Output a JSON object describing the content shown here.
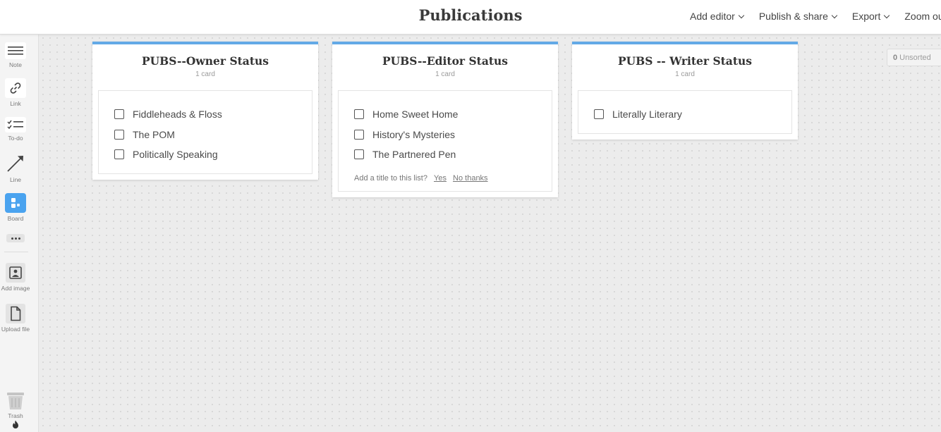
{
  "header": {
    "title": "Publications",
    "menu": [
      "Add editor",
      "Publish & share",
      "Export",
      "Zoom out"
    ]
  },
  "toolbar": {
    "tools": [
      {
        "name": "note",
        "label": "Note"
      },
      {
        "name": "link",
        "label": "Link"
      },
      {
        "name": "todo",
        "label": "To-do"
      },
      {
        "name": "line",
        "label": "Line"
      },
      {
        "name": "board",
        "label": "Board"
      },
      {
        "name": "add-image",
        "label": "Add image"
      },
      {
        "name": "upload-file",
        "label": "Upload file"
      }
    ],
    "trash_label": "Trash"
  },
  "columns": [
    {
      "title": "PUBS--Owner Status",
      "count": "1 card",
      "items": [
        "Fiddleheads & Floss",
        "The POM",
        "Politically Speaking"
      ]
    },
    {
      "title": "PUBS--Editor Status",
      "count": "1 card",
      "items": [
        "Home Sweet Home",
        "History's Mysteries",
        "The Partnered Pen"
      ],
      "prompt": {
        "text": "Add a title to this list?",
        "yes": "Yes",
        "no": "No thanks"
      }
    },
    {
      "title": "PUBS -- Writer Status",
      "count": "1 card",
      "items": [
        "Literally Literary"
      ]
    }
  ],
  "unsorted": {
    "count": "0",
    "label": "Unsorted"
  },
  "colors": {
    "accent": "#63a9e6",
    "board_icon": "#4aa3ef"
  }
}
